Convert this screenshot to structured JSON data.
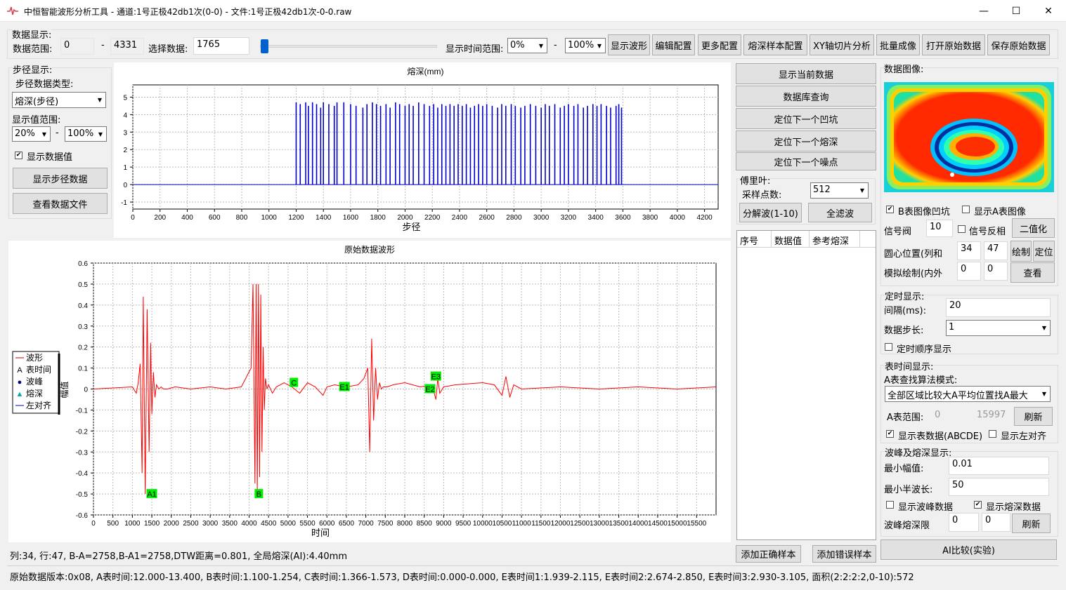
{
  "window": {
    "title": "中恒智能波形分析工具 - 通道:1号正极42db1次(0-0) - 文件:1号正极42db1次-0-0.raw",
    "app_icon": "waveform-icon",
    "minimize": "—",
    "maximize": "☐",
    "close": "✕"
  },
  "data_display": {
    "group": "数据显示:",
    "range_label": "数据范围:",
    "range_from": "0",
    "dash": "-",
    "range_to": "4331",
    "select_label": "选择数据:",
    "select_value": "1765",
    "slider_fraction": 0.007,
    "time_range_label": "显示时间范围:",
    "time_from": "0%",
    "time_to": "100%",
    "buttons": [
      "显示波形",
      "编辑配置",
      "更多配置",
      "熔深样本配置",
      "XY轴切片分析",
      "批量成像",
      "打开原始数据",
      "保存原始数据"
    ]
  },
  "step": {
    "group": "步径显示:",
    "type_label": "步径数据类型:",
    "type_value": "熔深(步径)",
    "range_label": "显示值范围:",
    "range_from": "20%",
    "dash": "-",
    "range_to": "100%",
    "show_values": "显示数据值",
    "show_values_checked": true,
    "btn_show": "显示步径数据",
    "btn_view": "查看数据文件"
  },
  "middle": {
    "buttons": [
      "显示当前数据",
      "数据库查询",
      "定位下一个凹坑",
      "定位下一个熔深",
      "定位下一个噪点"
    ],
    "fourier_label": "傅里叶:",
    "samples_label": "采样点数:",
    "samples_value": "512",
    "btn_decompose": "分解波(1-10)",
    "btn_full": "全滤波",
    "table_headers": [
      "序号",
      "数据值",
      "参考熔深"
    ],
    "btn_add_correct": "添加正确样本",
    "btn_add_wrong": "添加错误样本"
  },
  "right": {
    "image_label": "数据图像:",
    "cb_b_pit": "B表图像凹坑",
    "cb_b_checked": true,
    "cb_show_a": "显示A表图像",
    "signal_threshold_label": "信号阀",
    "signal_threshold": "10",
    "cb_invert": "信号反相",
    "btn_binarize": "二值化",
    "center_label": "圆心位置(列和",
    "center_x": "34",
    "center_y": "47",
    "btn_draw": "绘制",
    "btn_locate": "定位",
    "sim_label": "模拟绘制(内外",
    "sim_in": "0",
    "sim_out": "0",
    "btn_view": "查看",
    "timer_group": "定时显示:",
    "interval_label": "间隔(ms):",
    "interval": "20",
    "step_label": "数据步长:",
    "step_value": "1",
    "cb_timer_seq": "定时顺序显示",
    "table_time_group": "表时间显示:",
    "a_mode_label": "A表查找算法模式:",
    "a_mode_value": "全部区域比较大A平均位置找A最大",
    "a_range_label": "A表范围:",
    "a_from": "0",
    "a_to": "15997",
    "btn_refresh1": "刷新",
    "cb_show_table": "显示表数据(ABCDE)",
    "cb_show_table_checked": true,
    "cb_left_align": "显示左对齐",
    "peak_group": "波峰及熔深显示:",
    "min_amp_label": "最小幅值:",
    "min_amp": "0.01",
    "min_half_label": "最小半波长:",
    "min_half": "50",
    "cb_peak_data": "显示波峰数据",
    "cb_depth_data": "显示熔深数据",
    "cb_depth_checked": true,
    "depth_limit_label": "波峰熔深限",
    "depth_lo": "0",
    "depth_hi": "0",
    "btn_refresh2": "刷新",
    "btn_ai": "AI比较(实验)"
  },
  "status1": "列:34, 行:47, B-A=2758,B-A1=2758,DTW距离=0.801, 全局熔深(AI):4.40mm",
  "status2": "原始数据版本:0x08, A表时间:12.000-13.400, B表时间:1.100-1.254, C表时间:1.366-1.573, D表时间:0.000-0.000, E表时间1:1.939-2.115, E表时间2:2.674-2.850, E表时间3:2.930-3.105, 面积(2:2:2:2,0-10):572",
  "chart_data": [
    {
      "type": "bar",
      "title": "熔深(mm)",
      "xlabel": "步径",
      "ylabel": "",
      "xlim": [
        0,
        4300
      ],
      "ylim": [
        -1.4,
        5.7
      ],
      "grid": true,
      "color": "#0000cc",
      "x_ticks": [
        0,
        200,
        400,
        600,
        800,
        1000,
        1200,
        1400,
        1600,
        1800,
        2000,
        2200,
        2400,
        2600,
        2800,
        3000,
        3200,
        3400,
        3600,
        3800,
        4000,
        4200
      ],
      "y_ticks": [
        -1,
        0,
        1,
        2,
        3,
        4,
        5
      ],
      "baseline": 0,
      "x": [
        1200,
        1230,
        1270,
        1290,
        1320,
        1350,
        1380,
        1400,
        1440,
        1480,
        1500,
        1550,
        1600,
        1640,
        1690,
        1720,
        1760,
        1790,
        1820,
        1860,
        1890,
        1930,
        1960,
        2000,
        2030,
        2060,
        2100,
        2140,
        2180,
        2210,
        2240,
        2270,
        2300,
        2330,
        2360,
        2390,
        2420,
        2450,
        2480,
        2510,
        2540,
        2570,
        2600,
        2640,
        2680,
        2710,
        2740,
        2780,
        2810,
        2850,
        2880,
        2920,
        2960,
        3000,
        3030,
        3060,
        3100,
        3140,
        3170,
        3200,
        3240,
        3270,
        3310,
        3340,
        3380,
        3410,
        3440,
        3480,
        3510,
        3550,
        3570,
        3590
      ],
      "values": [
        4.7,
        4.6,
        4.7,
        4.5,
        4.7,
        4.6,
        4.4,
        4.7,
        4.6,
        4.5,
        4.7,
        4.7,
        4.6,
        4.5,
        4.4,
        4.6,
        4.7,
        4.6,
        4.5,
        4.6,
        4.4,
        4.7,
        4.6,
        4.5,
        4.6,
        4.5,
        4.7,
        4.6,
        4.5,
        4.6,
        4.4,
        4.6,
        4.5,
        4.6,
        4.5,
        4.6,
        4.5,
        4.6,
        4.4,
        4.5,
        4.6,
        4.5,
        4.6,
        4.5,
        4.4,
        4.6,
        4.5,
        4.6,
        4.5,
        4.4,
        4.5,
        4.6,
        4.5,
        4.4,
        4.6,
        4.5,
        4.6,
        4.4,
        4.5,
        4.6,
        4.5,
        4.6,
        4.4,
        4.5,
        4.6,
        4.5,
        4.6,
        4.5,
        4.4,
        4.5,
        4.6,
        4.4
      ]
    },
    {
      "type": "line",
      "title": "原始数据波形",
      "xlabel": "时间",
      "ylabel": "幅值",
      "xlim": [
        0,
        16000
      ],
      "ylim": [
        -0.6,
        0.6
      ],
      "grid": true,
      "x_ticks": [
        0,
        500,
        1000,
        1500,
        2000,
        2500,
        3000,
        3500,
        4000,
        4500,
        5000,
        5500,
        6000,
        6500,
        7000,
        7500,
        8000,
        8500,
        9000,
        9500,
        10000,
        10500,
        11000,
        11500,
        12000,
        12500,
        13000,
        13500,
        14000,
        14500,
        15000,
        15500
      ],
      "y_ticks": [
        -0.6,
        -0.5,
        -0.4,
        -0.3,
        -0.2,
        -0.1,
        0,
        0.1,
        0.2,
        0.3,
        0.4,
        0.5,
        0.6
      ],
      "legend": [
        "波形",
        "表时间",
        "波峰",
        "熔深",
        "左对齐"
      ],
      "legend_symbols": [
        "—",
        "A",
        "●",
        "▲",
        "—"
      ],
      "legend_colors": [
        "#cc0000",
        "#000000",
        "#000080",
        "#00aaaa",
        "#0000cc"
      ],
      "legend_position": "left",
      "series": [
        {
          "name": "波形",
          "color": "#ff0000",
          "x": [
            0,
            1000,
            1100,
            1150,
            1200,
            1250,
            1280,
            1330,
            1380,
            1430,
            1470,
            1500,
            1540,
            1580,
            1620,
            1680,
            1740,
            1800,
            1900,
            2100,
            2500,
            3000,
            3400,
            3800,
            4050,
            4100,
            4150,
            4180,
            4210,
            4240,
            4270,
            4300,
            4330,
            4360,
            4390,
            4420,
            4460,
            4500,
            4600,
            4700,
            4900,
            5100,
            5300,
            5500,
            5700,
            5900,
            6000,
            6200,
            6500,
            6800,
            6950,
            7050,
            7100,
            7150,
            7200,
            7250,
            7300,
            7350,
            7400,
            7450,
            7550,
            7700,
            8000,
            8400,
            8700,
            8800,
            8850,
            8900,
            9000,
            9300,
            10000,
            10300,
            10500,
            10600,
            10700,
            10800,
            11000,
            12000,
            13000,
            14000,
            15000,
            16000
          ],
          "y": [
            0,
            0.01,
            -0.02,
            0.03,
            0.12,
            -0.4,
            0.44,
            -0.5,
            0.38,
            -0.3,
            0.22,
            -0.12,
            0.08,
            -0.04,
            0.02,
            0,
            0.01,
            0,
            0,
            0.01,
            0,
            0.01,
            0,
            0.01,
            0.1,
            0.5,
            -0.45,
            0.5,
            -0.5,
            0.5,
            -0.42,
            0.45,
            -0.3,
            0.2,
            -0.1,
            0.05,
            0,
            0.02,
            -0.02,
            0.01,
            0.03,
            0.01,
            -0.02,
            0.03,
            0.01,
            -0.03,
            0.01,
            0.02,
            0.01,
            0.02,
            0.05,
            0.1,
            -0.3,
            0.24,
            -0.15,
            0.1,
            -0.05,
            0.03,
            0,
            0.01,
            0.01,
            0.02,
            0.03,
            0.01,
            0.02,
            -0.05,
            0.05,
            -0.02,
            0.01,
            0.02,
            0.03,
            0.02,
            -0.03,
            0.06,
            -0.04,
            0.02,
            0,
            0.01,
            0,
            0.01,
            0,
            0.01
          ]
        }
      ],
      "annotations": [
        {
          "label": "A1",
          "x": 1500,
          "y": -0.5
        },
        {
          "label": "B",
          "x": 4250,
          "y": -0.5
        },
        {
          "label": "C",
          "x": 5150,
          "y": 0.03
        },
        {
          "label": "E1",
          "x": 6450,
          "y": 0.01
        },
        {
          "label": "E2",
          "x": 8650,
          "y": 0.0
        },
        {
          "label": "E3",
          "x": 8800,
          "y": 0.06
        }
      ]
    }
  ]
}
